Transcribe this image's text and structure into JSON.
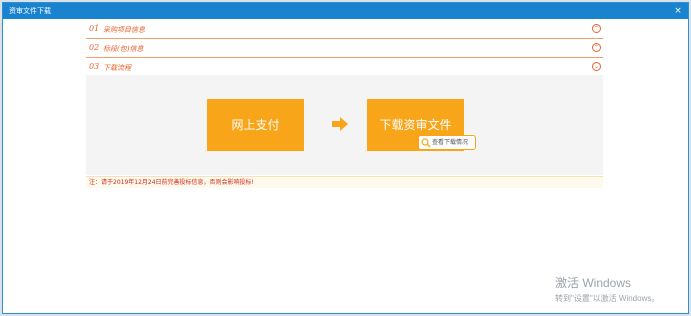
{
  "window": {
    "title": "资审文件下载",
    "close_symbol": "×"
  },
  "sections": [
    {
      "num": "01",
      "label": "采购项目信息",
      "toggle": "⌃"
    },
    {
      "num": "02",
      "label": "标段(包)信息",
      "toggle": "⌃"
    },
    {
      "num": "03",
      "label": "下载流程",
      "toggle": "⌄"
    }
  ],
  "flow": {
    "step1_label": "网上支付",
    "step2_label": "下载资审文件",
    "view_status_label": "查看下载情况"
  },
  "note": "注：请于2019年12月24日前完善投标信息，否则会影响投标!",
  "watermark": {
    "line1": "激活 Windows",
    "line2": "转到\"设置\"以激活 Windows。"
  },
  "colors": {
    "titlebar": "#1a83d0",
    "accent": "#e8622c",
    "step": "#f9a51a",
    "note": "#d9281b"
  }
}
